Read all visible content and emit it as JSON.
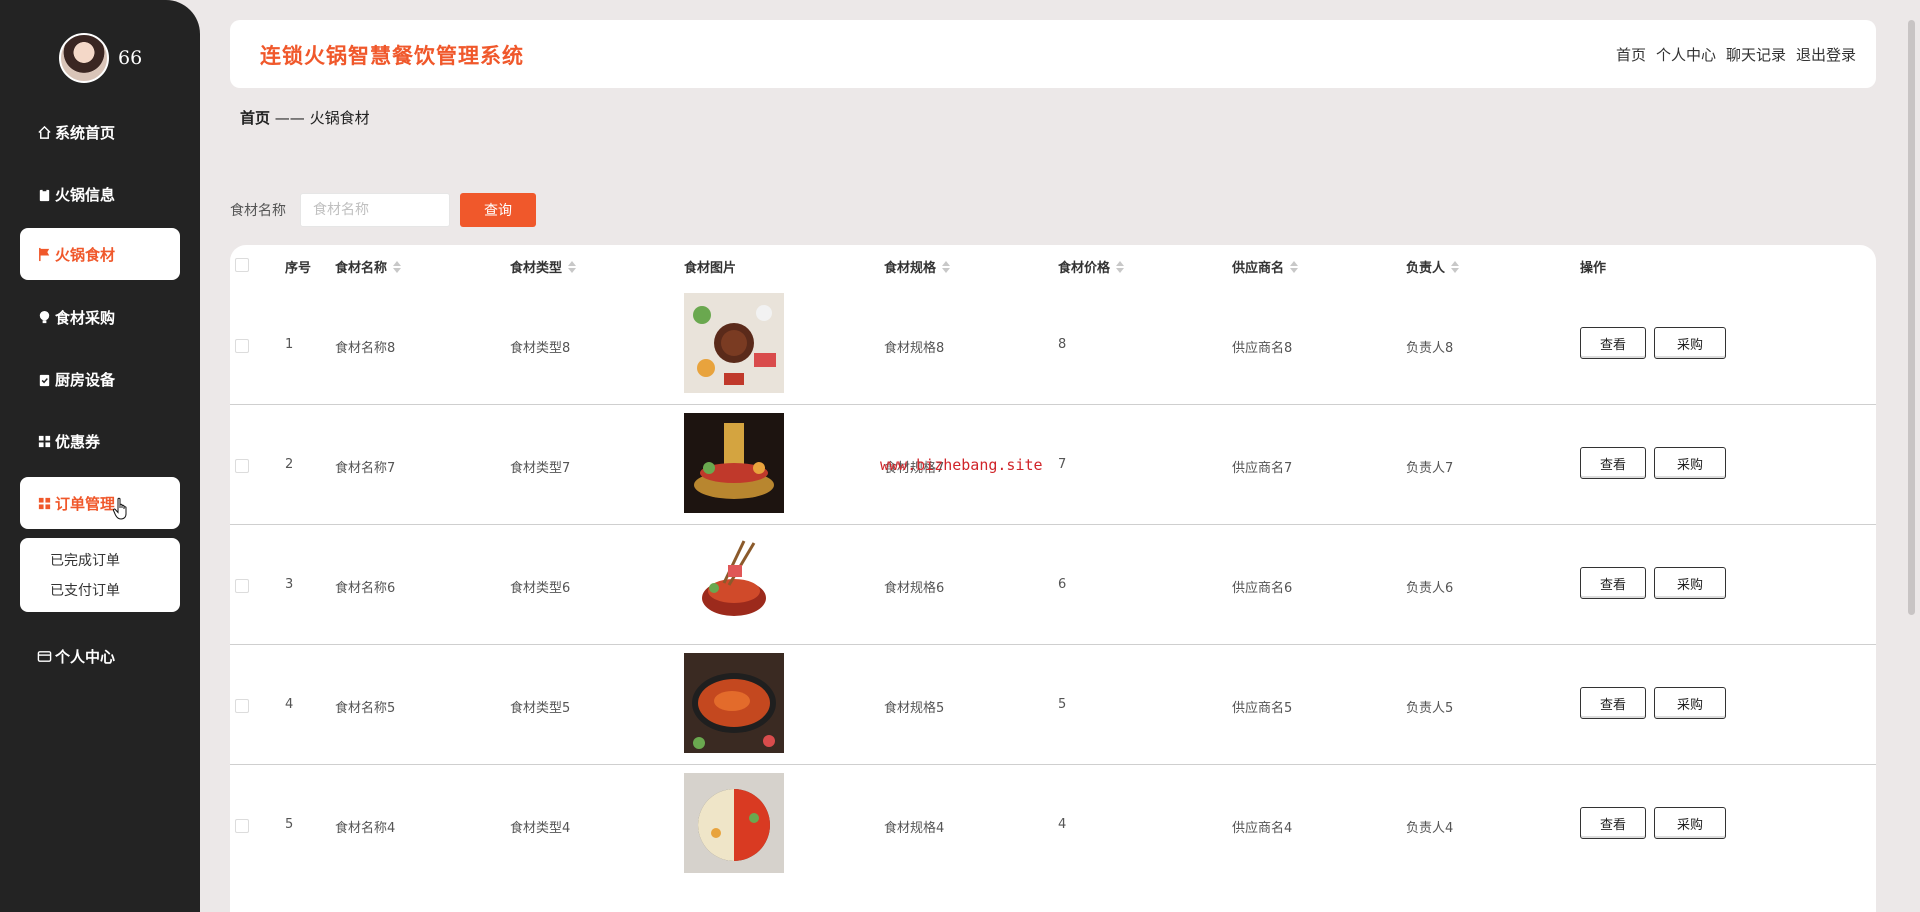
{
  "user": {
    "name": "66"
  },
  "sidebar": {
    "items": [
      {
        "label": "系统首页",
        "icon": "home-icon"
      },
      {
        "label": "火锅信息",
        "icon": "clipboard-icon"
      },
      {
        "label": "火锅食材",
        "icon": "flag-icon"
      },
      {
        "label": "食材采购",
        "icon": "bulb-icon"
      },
      {
        "label": "厨房设备",
        "icon": "clipboard-check-icon"
      },
      {
        "label": "优惠券",
        "icon": "grid-icon"
      },
      {
        "label": "订单管理",
        "icon": "grid-icon"
      },
      {
        "label": "个人中心",
        "icon": "card-icon"
      }
    ],
    "submenu": [
      "已完成订单",
      "已支付订单"
    ]
  },
  "header": {
    "title": "连锁火锅智慧餐饮管理系统",
    "nav": [
      "首页",
      "个人中心",
      "聊天记录",
      "退出登录"
    ]
  },
  "breadcrumb": {
    "home": "首页",
    "separator": "——",
    "current": "火锅食材"
  },
  "search": {
    "label": "食材名称",
    "placeholder": "食材名称",
    "button": "查询"
  },
  "table": {
    "headers": [
      "序号",
      "食材名称",
      "食材类型",
      "食材图片",
      "食材规格",
      "食材价格",
      "供应商名",
      "负责人",
      "操作"
    ],
    "view_label": "查看",
    "buy_label": "采购",
    "rows": [
      {
        "index": "1",
        "name": "食材名称8",
        "type": "食材类型8",
        "spec": "食材规格8",
        "price": "8",
        "supplier": "供应商名8",
        "owner": "负责人8"
      },
      {
        "index": "2",
        "name": "食材名称7",
        "type": "食材类型7",
        "spec": "食材规格7",
        "price": "7",
        "supplier": "供应商名7",
        "owner": "负责人7"
      },
      {
        "index": "3",
        "name": "食材名称6",
        "type": "食材类型6",
        "spec": "食材规格6",
        "price": "6",
        "supplier": "供应商名6",
        "owner": "负责人6"
      },
      {
        "index": "4",
        "name": "食材名称5",
        "type": "食材类型5",
        "spec": "食材规格5",
        "price": "5",
        "supplier": "供应商名5",
        "owner": "负责人5"
      },
      {
        "index": "5",
        "name": "食材名称4",
        "type": "食材类型4",
        "spec": "食材规格4",
        "price": "4",
        "supplier": "供应商名4",
        "owner": "负责人4"
      }
    ]
  },
  "watermark": "www.bizhebang.site",
  "colors": {
    "accent": "#f0582b",
    "sidebar_bg": "#232323",
    "page_bg": "#ece8e8"
  }
}
